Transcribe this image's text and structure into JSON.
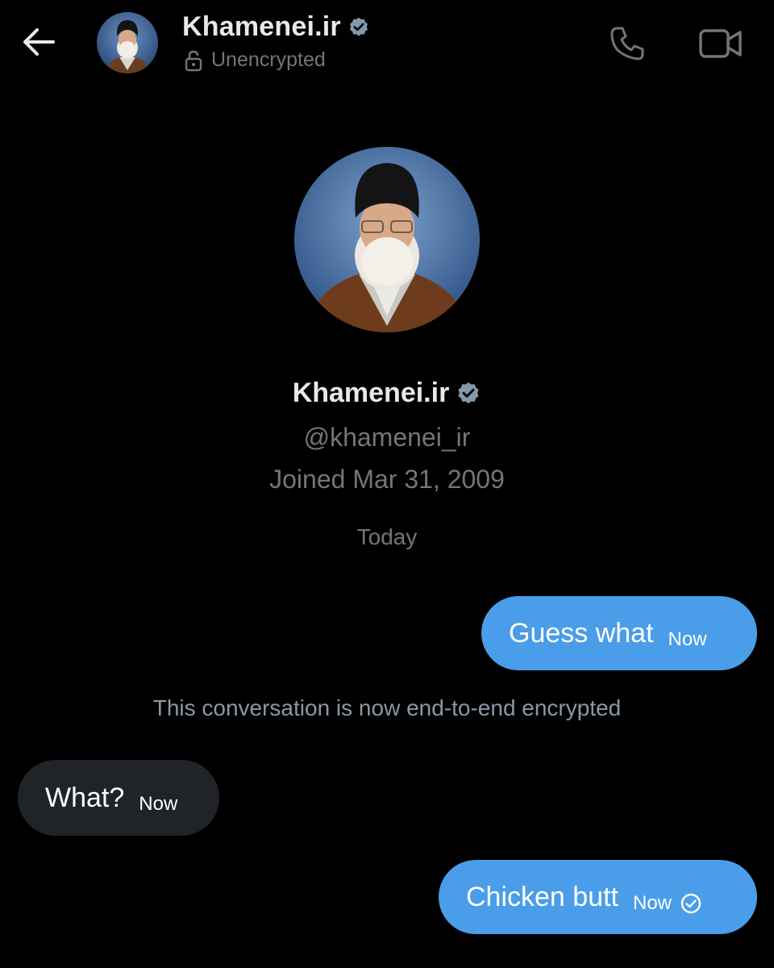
{
  "header": {
    "name": "Khamenei.ir",
    "status": "Unencrypted",
    "back_icon": "arrow-left-icon",
    "lock_icon": "unlocked-padlock-icon",
    "call_icon": "phone-icon",
    "video_icon": "video-camera-icon",
    "verified_icon": "verified-badge-icon"
  },
  "profile": {
    "name": "Khamenei.ir",
    "handle": "@khamenei_ir",
    "joined": "Joined Mar 31, 2009"
  },
  "date_divider": "Today",
  "system_note": "This conversation is now end-to-end encrypted",
  "messages": [
    {
      "direction": "sent",
      "text": "Guess what",
      "time": "Now"
    },
    {
      "direction": "received",
      "text": "What?",
      "time": "Now"
    },
    {
      "direction": "sent",
      "text": "Chicken butt",
      "time": "Now",
      "status_icon": "read-check-circle-icon"
    }
  ],
  "colors": {
    "background": "#000000",
    "sent_bubble": "#4a9de8",
    "received_bubble": "#202327",
    "secondary_text": "#71767b",
    "verified_badge": "#829aab"
  }
}
